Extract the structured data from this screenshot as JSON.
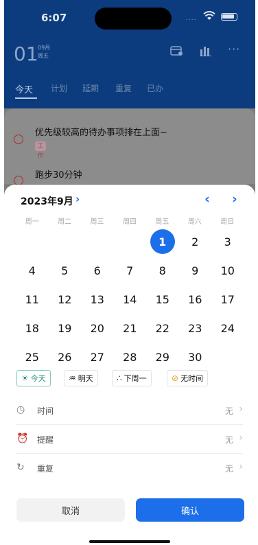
{
  "status_bar": {
    "time": "6:07",
    "signal": "...."
  },
  "header": {
    "day": "01",
    "month": "09月",
    "weekday": "周五",
    "icons": [
      "calendar-search-icon",
      "bar-chart-icon",
      "more-icon"
    ]
  },
  "tabs": [
    "今天",
    "计划",
    "延期",
    "重复",
    "已办"
  ],
  "tasks": [
    {
      "title": "优先级较高的待办事项排在上面~",
      "tag": "工作"
    },
    {
      "title": "跑步30分钟"
    }
  ],
  "picker": {
    "month_label": "2023年9月",
    "weekdays": [
      "周一",
      "周二",
      "周三",
      "周四",
      "周五",
      "周六",
      "周日"
    ],
    "leading_blanks": 4,
    "days": [
      "1",
      "2",
      "3",
      "4",
      "5",
      "6",
      "7",
      "8",
      "9",
      "10",
      "11",
      "12",
      "13",
      "14",
      "15",
      "16",
      "17",
      "18",
      "19",
      "20",
      "21",
      "22",
      "23",
      "24",
      "25",
      "26",
      "27",
      "28",
      "29",
      "30"
    ],
    "selected_day": "1",
    "accent_color": "#1c6fe8",
    "quick_options": [
      {
        "label": "今天",
        "icon": "sun-icon",
        "active": true
      },
      {
        "label": "明天",
        "icon": "sunrise-icon",
        "active": false
      },
      {
        "label": "下周一",
        "icon": "sunset-icon",
        "active": false
      },
      {
        "label": "无时间",
        "icon": "no-time-icon",
        "active": false
      }
    ],
    "options": [
      {
        "label": "时间",
        "value": "无",
        "icon": "clock-icon"
      },
      {
        "label": "提醒",
        "value": "无",
        "icon": "alarm-icon"
      },
      {
        "label": "重复",
        "value": "无",
        "icon": "repeat-icon"
      }
    ],
    "cancel_label": "取消",
    "confirm_label": "确认"
  }
}
